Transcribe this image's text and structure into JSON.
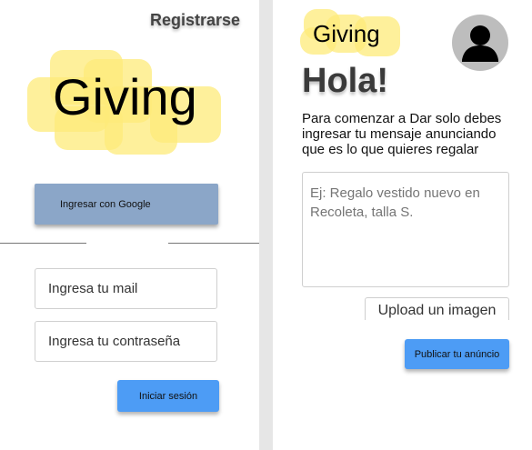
{
  "login": {
    "register_label": "Registrarse",
    "logo_text": "Giving",
    "google_button_label": "Ingresar  con Google",
    "mail_placeholder": "Ingresa tu mail",
    "password_placeholder": "Ingresa tu contraseña",
    "login_button_label": "Iniciar sesión"
  },
  "post": {
    "logo_text": "Giving",
    "greeting": "Hola!",
    "intro_text": "Para comenzar a Dar solo debes ingresar tu mensaje anunciando que es lo que quieres regalar",
    "message_placeholder": "Ej: Regalo vestido nuevo en Recoleta, talla S.",
    "upload_button_label": "Upload un imagen",
    "publish_button_label": "Publicar tu anúncio"
  },
  "colors": {
    "logo_highlight": "#fdeb7a",
    "google_button": "#8ba6c8",
    "primary_button": "#4d9cf5",
    "avatar_bg": "#bdbdbd"
  },
  "icons": {
    "avatar": "user-silhouette-icon"
  }
}
